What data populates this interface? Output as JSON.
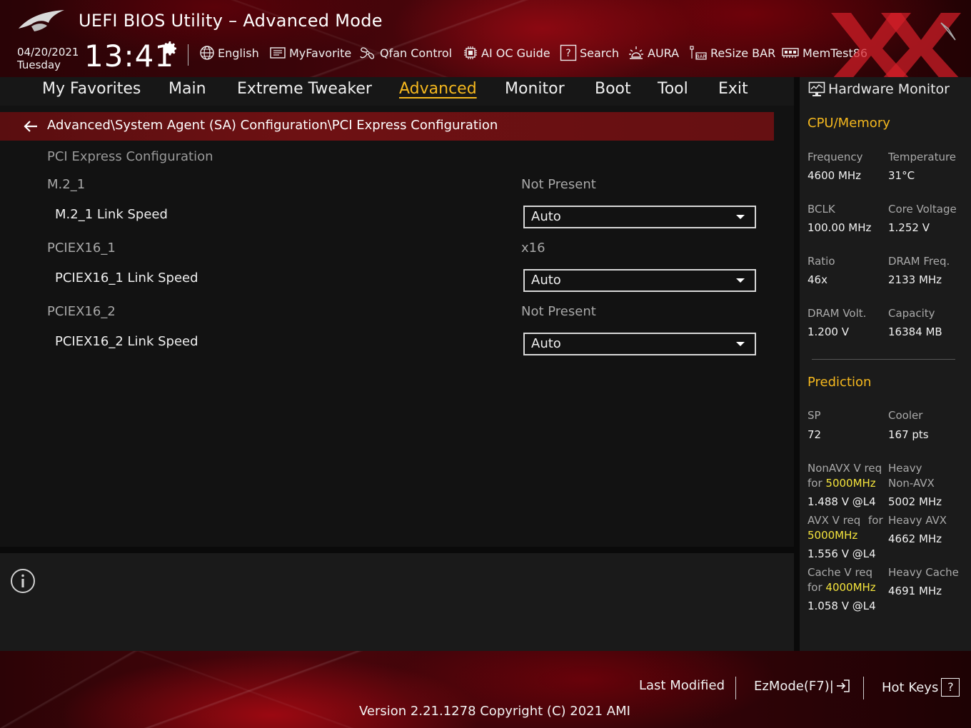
{
  "header": {
    "title": "UEFI BIOS Utility – Advanced Mode",
    "date": "04/20/2021",
    "day": "Tuesday",
    "time": "13:41",
    "toolbar": [
      {
        "label": "English",
        "icon": "globe-icon"
      },
      {
        "label": "MyFavorite",
        "icon": "favorite-list-icon"
      },
      {
        "label": "Qfan Control",
        "icon": "fan-icon"
      },
      {
        "label": "AI OC Guide",
        "icon": "chip-icon"
      },
      {
        "label": "Search",
        "icon": "help-search-icon"
      },
      {
        "label": "AURA",
        "icon": "aura-light-icon"
      },
      {
        "label": "ReSize BAR",
        "icon": "resize-bar-icon"
      },
      {
        "label": "MemTest86",
        "icon": "memory-icon"
      }
    ]
  },
  "nav": {
    "tabs": [
      {
        "label": "My Favorites"
      },
      {
        "label": "Main"
      },
      {
        "label": "Extreme Tweaker"
      },
      {
        "label": "Advanced",
        "active": true
      },
      {
        "label": "Monitor"
      },
      {
        "label": "Boot"
      },
      {
        "label": "Tool"
      },
      {
        "label": "Exit"
      }
    ]
  },
  "breadcrumb": "Advanced\\System Agent (SA) Configuration\\PCI Express Configuration",
  "settings": {
    "heading": "PCI Express Configuration",
    "rows": [
      {
        "label": "M.2_1",
        "value": "Not Present"
      },
      {
        "label": "M.2_1 Link Speed",
        "selected": "Auto"
      },
      {
        "label": "PCIEX16_1",
        "value": "x16"
      },
      {
        "label": "PCIEX16_1 Link Speed",
        "selected": "Auto"
      },
      {
        "label": "PCIEX16_2",
        "value": "Not Present"
      },
      {
        "label": "PCIEX16_2 Link Speed",
        "selected": "Auto"
      }
    ]
  },
  "hw_monitor": {
    "title": "Hardware Monitor",
    "cpu_memory": {
      "section": "CPU/Memory",
      "frequency_label": "Frequency",
      "frequency": "4600 MHz",
      "temperature_label": "Temperature",
      "temperature": "31°C",
      "bclk_label": "BCLK",
      "bclk": "100.00 MHz",
      "core_voltage_label": "Core Voltage",
      "core_voltage": "1.252 V",
      "ratio_label": "Ratio",
      "ratio": "46x",
      "dram_freq_label": "DRAM Freq.",
      "dram_freq": "2133 MHz",
      "dram_volt_label": "DRAM Volt.",
      "dram_volt": "1.200 V",
      "capacity_label": "Capacity",
      "capacity": "16384 MB"
    },
    "prediction": {
      "section": "Prediction",
      "sp_label": "SP",
      "sp": "72",
      "cooler_label": "Cooler",
      "cooler": "167 pts",
      "nonavx_label": "NonAVX V req",
      "nonavx_for": "for",
      "nonavx_freq": "5000MHz",
      "nonavx_value": "1.488 V @L4",
      "heavy_nonavx_label1": "Heavy",
      "heavy_nonavx_label2": "Non-AVX",
      "heavy_nonavx_value": "5002 MHz",
      "avx_label": "AVX V req",
      "avx_for": "for",
      "avx_freq": "5000MHz",
      "avx_value": "1.556 V @L4",
      "heavy_avx_label": "Heavy AVX",
      "heavy_avx_value": "4662 MHz",
      "cache_label": "Cache V req",
      "cache_for": "for",
      "cache_freq": "4000MHz",
      "cache_value": "1.058 V @L4",
      "heavy_cache_label": "Heavy Cache",
      "heavy_cache_value": "4691 MHz"
    }
  },
  "footer": {
    "last_modified": "Last Modified",
    "ezmode": "EzMode(F7)|",
    "hot_keys": "Hot Keys",
    "hot_keys_badge": "?",
    "version": "Version 2.21.1278 Copyright (C) 2021 AMI"
  },
  "colors": {
    "accent": "#f5b81e",
    "highlight_freq": "#f5e43c",
    "breadcrumb_bg": "#6e1113",
    "background": "#121212",
    "panel": "#1b1b1b"
  }
}
